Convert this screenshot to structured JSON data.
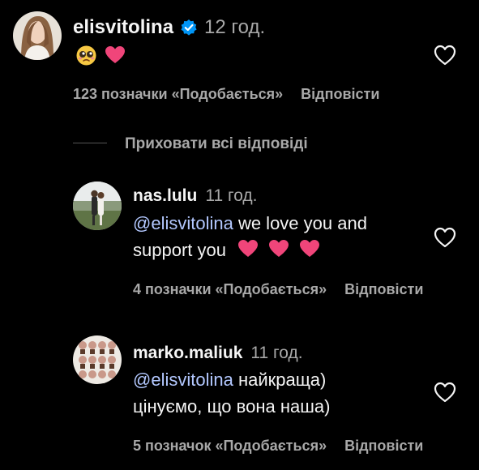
{
  "comment": {
    "username": "elisvitolina",
    "time": "12 год.",
    "likes_label": "123 позначки «Подобається»",
    "reply_label": "Відповісти"
  },
  "hide_replies_label": "Приховати всі відповіді",
  "replies": [
    {
      "username": "nas.lulu",
      "time": "11 год.",
      "mention": "@elisvitolina",
      "text_line1": " we love you and",
      "text_line2": "support you",
      "likes_label": "4 позначки «Подобається»",
      "reply_label": "Відповісти"
    },
    {
      "username": "marko.maliuk",
      "time": "11 год.",
      "mention": "@elisvitolina",
      "text_line1": " найкраща)",
      "text_line2": "цінуємо, що вона наша)",
      "likes_label": "5 позначок «Подобається»",
      "reply_label": "Відповісти"
    }
  ],
  "colors": {
    "background": "#000000",
    "text": "#f5f5f5",
    "muted": "#a8a8a8",
    "mention": "#b3c8ff",
    "verified": "#0095f6",
    "heart_emoji": "#f0457a"
  },
  "icons": {
    "verified": "verified-badge-icon",
    "like": "heart-outline-icon",
    "emoji_face": "pleading-face-emoji",
    "emoji_heart": "pink-heart-emoji"
  }
}
